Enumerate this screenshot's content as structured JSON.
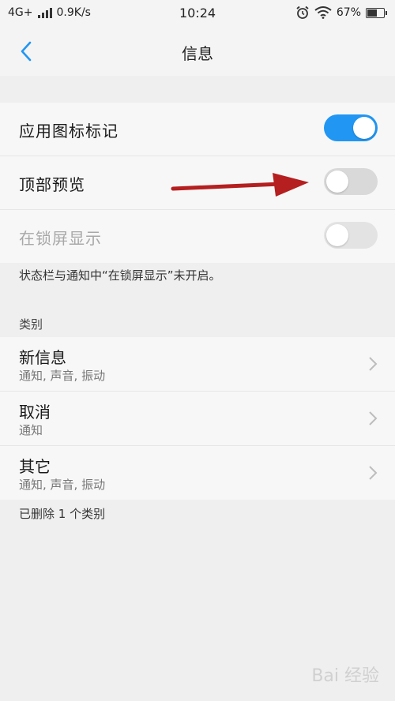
{
  "status_bar": {
    "network": "4G+",
    "speed": "0.9K/s",
    "time": "10:24",
    "battery": "67%",
    "battery_level": 0.67,
    "icons": [
      "alarm-icon",
      "wifi-icon"
    ]
  },
  "header": {
    "title": "信息",
    "back_icon": "chevron-left-icon"
  },
  "toggles": [
    {
      "label": "应用图标标记",
      "state": "on",
      "enabled": true
    },
    {
      "label": "顶部预览",
      "state": "off",
      "enabled": true
    },
    {
      "label": "在锁屏显示",
      "state": "off",
      "enabled": false
    }
  ],
  "lockscreen_note": "状态栏与通知中“在锁屏显示”未开启。",
  "categories": {
    "header": "类别",
    "items": [
      {
        "title": "新信息",
        "subtitle": "通知, 声音, 振动"
      },
      {
        "title": "取消",
        "subtitle": "通知"
      },
      {
        "title": "其它",
        "subtitle": "通知, 声音, 振动"
      }
    ],
    "footer": "已删除 1 个类别"
  },
  "colors": {
    "accent": "#2196f3",
    "annotation_arrow": "#b51f1f"
  },
  "watermark": "Bai 经验"
}
